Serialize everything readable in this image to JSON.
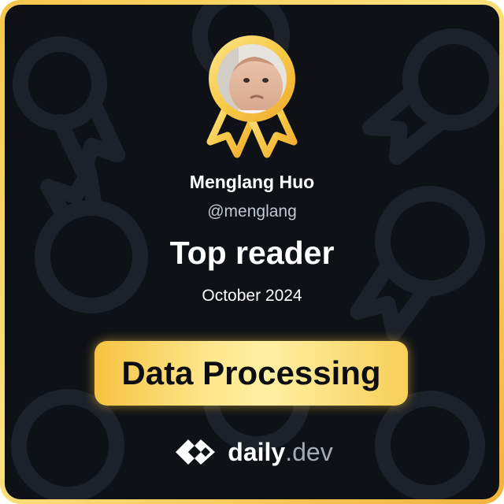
{
  "user": {
    "name": "Menglang Huo",
    "handle": "@menglang"
  },
  "award": {
    "title": "Top reader",
    "period": "October 2024",
    "topic": "Data Processing"
  },
  "brand": {
    "name_main": "daily",
    "name_suffix": ".dev",
    "logo_icon": "daily-dev-logo-icon"
  },
  "colors": {
    "background": "#0e1116",
    "gold": "#f7c948",
    "gold_light": "#fde589",
    "text": "#ffffff",
    "muted_text": "#c3c7cf",
    "logo_suffix": "#a6aab4"
  },
  "icons": {
    "badge": "award-ribbon-icon",
    "avatar": "user-avatar"
  }
}
